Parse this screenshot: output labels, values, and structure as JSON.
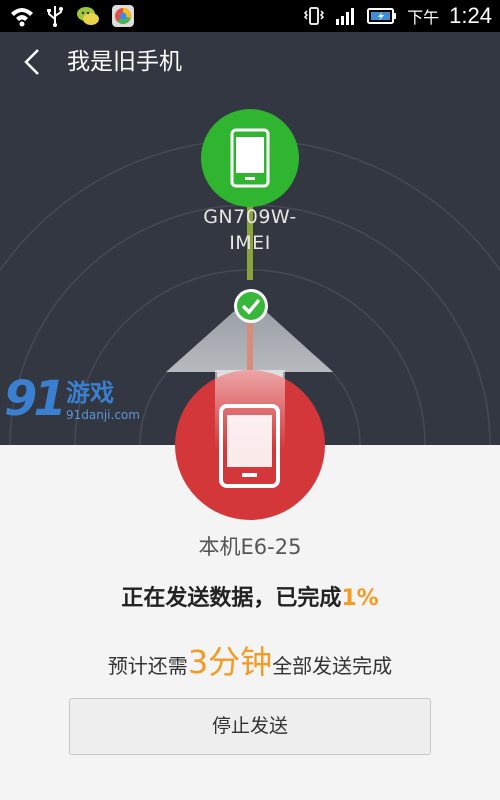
{
  "status_bar": {
    "ampm": "下午",
    "time": "1:24",
    "icons": [
      "wifi-icon",
      "usb-icon",
      "chat-app-icon",
      "colorful-app-icon",
      "vibrate-icon",
      "signal-icon",
      "battery-icon"
    ]
  },
  "header": {
    "back_icon": "chevron-left-icon",
    "title": "我是旧手机"
  },
  "old_device": {
    "name_line1": "GN709W-",
    "name_line2": "IMEI",
    "icon": "phone-icon",
    "color": "#2fb530"
  },
  "transfer": {
    "check_icon": "check-icon",
    "arrow_icon": "up-arrow-icon"
  },
  "this_device": {
    "name": "本机E6-25",
    "icon": "phone-icon",
    "color": "#d4373a"
  },
  "progress": {
    "label": "正在发送数据，已完成",
    "percent_text": "1%",
    "percent": 1,
    "accent_color": "#f59a23"
  },
  "estimate": {
    "prefix": "预计还需",
    "time": "3分钟",
    "suffix": "全部发送完成"
  },
  "stop_button": {
    "label": "停止发送"
  },
  "watermark": {
    "number": "91",
    "text": "游戏",
    "sub": "91danji.com"
  }
}
